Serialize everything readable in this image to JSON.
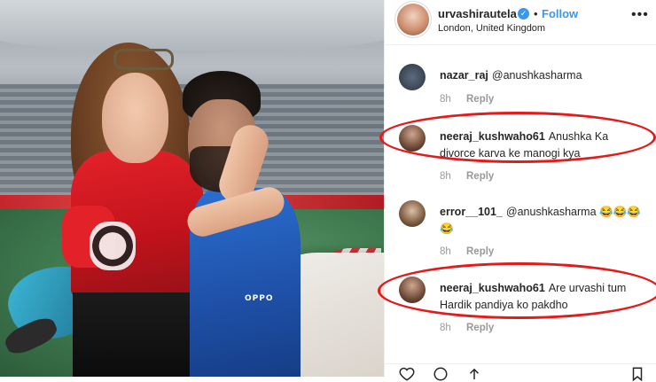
{
  "post": {
    "username": "urvashirautela",
    "verified_icon": "verified-badge-icon",
    "separator": "•",
    "follow_label": "Follow",
    "location": "London, United Kingdom",
    "more_icon": "more-options-icon"
  },
  "comments": [
    {
      "username": "nazar_raj",
      "text": "@anushkasharma",
      "time": "8h",
      "reply": "Reply"
    },
    {
      "username": "neeraj_kushwaho61",
      "text": "Anushka Ka divorce karva ke manogi kya",
      "time": "8h",
      "reply": "Reply"
    },
    {
      "username": "error__101_",
      "text": "@anushkasharma 😂😂😂😂",
      "time": "8h",
      "reply": "Reply"
    },
    {
      "username": "neeraj_kushwaho61",
      "text": "Are urvashi tum Hardik pandiya ko pakdho",
      "time": "8h",
      "reply": "Reply"
    }
  ],
  "photo": {
    "jersey_text": "OPPO"
  },
  "highlight_color": "#e21b1b",
  "accent_color": "#3897f0"
}
